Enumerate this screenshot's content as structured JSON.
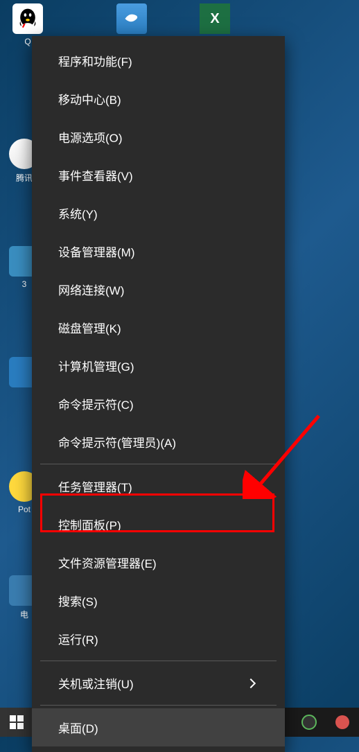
{
  "desktop": {
    "qq_label": "Q",
    "tencent_label": "腾讯",
    "num3_label": "3",
    "pot_label": "Pot",
    "shortcut_e_label": "电",
    "excel_label": "X"
  },
  "menu": {
    "group1": [
      "程序和功能(F)",
      "移动中心(B)",
      "电源选项(O)",
      "事件查看器(V)",
      "系统(Y)",
      "设备管理器(M)",
      "网络连接(W)",
      "磁盘管理(K)",
      "计算机管理(G)",
      "命令提示符(C)",
      "命令提示符(管理员)(A)"
    ],
    "group2": [
      "任务管理器(T)",
      "控制面板(P)",
      "文件资源管理器(E)",
      "搜索(S)",
      "运行(R)"
    ],
    "group3": {
      "shutdown": "关机或注销(U)"
    },
    "group4": {
      "desktop": "桌面(D)"
    }
  }
}
